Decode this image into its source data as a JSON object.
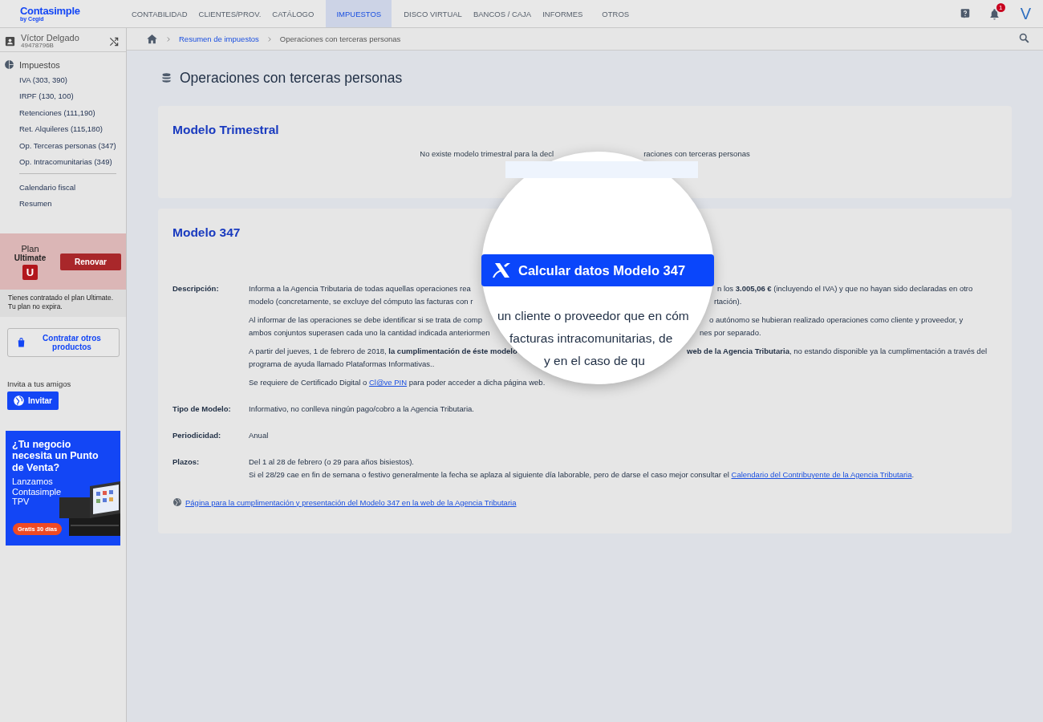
{
  "brand": {
    "name": "Contasimple",
    "sub": "by Cegid"
  },
  "nav": [
    {
      "label": "CONTABILIDAD",
      "selected": false
    },
    {
      "label": "CLIENTES/PROV.",
      "selected": false
    },
    {
      "label": "CATÁLOGO",
      "selected": false
    },
    {
      "label": "IMPUESTOS",
      "selected": true
    },
    {
      "label": "DISCO VIRTUAL",
      "selected": false
    },
    {
      "label": "BANCOS / CAJA",
      "selected": false
    },
    {
      "label": "INFORMES",
      "selected": false
    },
    {
      "label": "OTROS",
      "selected": false
    }
  ],
  "header": {
    "notification_count": "1",
    "avatar_letter": "V"
  },
  "user": {
    "name": "Víctor Delgado",
    "id": "49478796B"
  },
  "sidebar": {
    "section_title": "Impuestos",
    "items": [
      "IVA (303, 390)",
      "IRPF (130, 100)",
      "Retenciones (111,190)",
      "Ret. Alquileres (115,180)",
      "Op. Terceras personas (347)",
      "Op. Intracomunitarias (349)"
    ],
    "secondary_items": [
      "Calendario fiscal",
      "Resumen"
    ]
  },
  "plan": {
    "label": "Plan",
    "name": "Ultimate",
    "badge": "U",
    "button": "Renovar",
    "note": [
      "Tienes contratado el plan Ultimate.",
      "Tu plan no expira."
    ]
  },
  "products_button": "Contratar otros productos",
  "invite": {
    "label": "Invita a tus amigos",
    "button": "Invitar"
  },
  "promo": {
    "headline": "¿Tu negocio necesita un Punto de Venta?",
    "body": "Lanzamos Contasimple TPV",
    "badge": "Gratis 30 días"
  },
  "breadcrumb": [
    {
      "label": "Resumen de impuestos",
      "kind": "link"
    },
    {
      "label": "Operaciones con terceras personas",
      "kind": "current"
    }
  ],
  "page_title": "Operaciones con terceras personas",
  "trimestral": {
    "title": "Modelo Trimestral",
    "message_left": "No existe modelo trimestral para la decl",
    "message_right": "raciones con terceras personas"
  },
  "modelo": {
    "title": "Modelo 347",
    "rows": [
      {
        "label": "Descripción:",
        "paragraphs": [
          [
            {
              "kind": "split",
              "left": "Informa a la Agencia Tributaria de todas aquellas operaciones rea",
              "right": "n los **3.005,06 €** (incluyendo el IVA) y que no hayan sido declaradas en otro"
            },
            {
              "kind": "split",
              "left": "modelo (concretamente, se excluye del cómputo las facturas con r",
              "right": "rtación)."
            }
          ],
          [
            {
              "kind": "split",
              "left": "Al informar de las operaciones se debe identificar si se trata de comp",
              "right": "o autónomo se hubieran realizado operaciones como cliente y proveedor, y"
            },
            {
              "kind": "split",
              "left": "ambos conjuntos superasen cada uno la cantidad indicada anteriormen",
              "right": "nes por separado."
            }
          ],
          [
            {
              "kind": "split",
              "left": "A partir del jueves, 1 de febrero de 2018, **la cumplimentación de éste modelo**",
              "right": "**web de la Agencia Tributaria**, no estando disponible ya la cumplimentación a través del"
            },
            {
              "kind": "plain",
              "text": "programa de ayuda llamado Plataformas Informativas.."
            }
          ],
          [
            {
              "kind": "link",
              "before": "Se requiere de Certificado Digital o",
              "link": "Cl@ve PIN",
              "after": "para poder acceder a dicha página web."
            }
          ]
        ]
      },
      {
        "label": "Tipo de Modelo:",
        "paragraphs": [
          [
            {
              "kind": "plain",
              "text": "Informativo, no conlleva ningún pago/cobro a la Agencia Tributaria."
            }
          ]
        ]
      },
      {
        "label": "Periodicidad:",
        "paragraphs": [
          [
            {
              "kind": "plain",
              "text": "Anual"
            }
          ]
        ]
      },
      {
        "label": "Plazos:",
        "paragraphs": [
          [
            {
              "kind": "plain",
              "text": "Del 1 al 28 de febrero (o 29 para años bisiestos)."
            },
            {
              "kind": "link",
              "before": "Si el 28/29 cae en fin de semana o festivo generalmente la fecha se aplaza al siguiente día laborable, pero de darse el caso mejor consultar el",
              "link": "Calendario del Contribuyente de la Agencia Tributaria",
              "after": "."
            }
          ]
        ]
      }
    ],
    "footer_link": "Página para la cumplimentación y presentación del Modelo 347 en la web de la Agencia Tributaria"
  },
  "magnifier": {
    "button": "Calcular datos Modelo 347",
    "lines": [
      "un cliente o proveedor que en cóm",
      "facturas intracomunitarias, de",
      "y en el caso de qu"
    ]
  }
}
